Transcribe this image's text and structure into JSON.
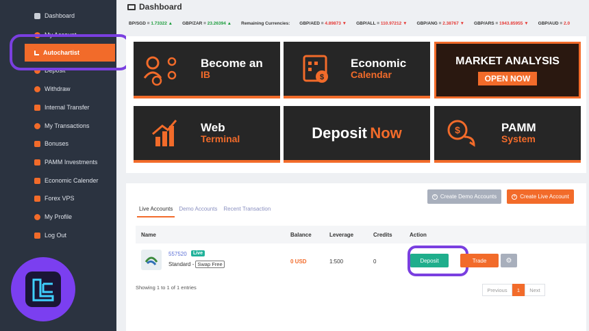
{
  "sidebar": {
    "items": [
      {
        "label": "Dashboard"
      },
      {
        "label": "My Account"
      },
      {
        "label": "Autochartist"
      },
      {
        "label": "Deposit"
      },
      {
        "label": "Withdraw"
      },
      {
        "label": "Internal Transfer"
      },
      {
        "label": "My Transactions"
      },
      {
        "label": "Bonuses"
      },
      {
        "label": "PAMM Investments"
      },
      {
        "label": "Economic Calender"
      },
      {
        "label": "Forex VPS"
      },
      {
        "label": "My Profile"
      },
      {
        "label": "Log Out"
      }
    ]
  },
  "header": {
    "title": "Dashboard"
  },
  "ticker": [
    {
      "pair": "BP/SGD =",
      "value": "1.73322 ▲",
      "dir": "up"
    },
    {
      "pair": "GBP/ZAR =",
      "value": "23.26394 ▲",
      "dir": "up"
    },
    {
      "pair": "Remaining Currencies:",
      "value": "",
      "dir": ""
    },
    {
      "pair": "GBP/AED =",
      "value": "4.89873 ▼",
      "dir": "down"
    },
    {
      "pair": "GBP/ALL =",
      "value": "110.97212 ▼",
      "dir": "down"
    },
    {
      "pair": "GBP/ANG =",
      "value": "2.38767 ▼",
      "dir": "down"
    },
    {
      "pair": "GBP/ARS =",
      "value": "1943.85955 ▼",
      "dir": "down"
    },
    {
      "pair": "GBP/AUD =",
      "value": "2.0",
      "dir": "down"
    }
  ],
  "banners": {
    "ib": {
      "line1": "Become an",
      "line2": "IB"
    },
    "calendar": {
      "line1": "Economic",
      "line2": "Calendar"
    },
    "market": {
      "title": "MARKET ANALYSIS",
      "button": "OPEN NOW"
    },
    "web": {
      "line1": "Web",
      "line2": "Terminal"
    },
    "deposit": {
      "word1": "Deposit",
      "word2": "Now"
    },
    "pamm": {
      "line1": "PAMM",
      "line2": "System"
    }
  },
  "accounts": {
    "create_demo": "Create Demo Accounts",
    "create_live": "Create Live Account",
    "tabs": [
      "Live Accounts",
      "Demo Accounts",
      "Recent Transaction"
    ],
    "columns": [
      "Name",
      "Balance",
      "Leverage",
      "Credits",
      "Action"
    ],
    "row": {
      "number": "557520",
      "badge": "Live",
      "type": "Standard -",
      "swap": "Swap Free",
      "balance": "0 USD",
      "leverage": "1:500",
      "credits": "0",
      "deposit_label": "Deposit",
      "trade_label": "Trade"
    },
    "showing": "Showing 1 to 1 of 1 entries",
    "pager": {
      "prev": "Previous",
      "page": "1",
      "next": "Next"
    }
  },
  "colors": {
    "accent": "#f26b2a",
    "sidebar": "#2b3340",
    "highlight": "#7a3fe0",
    "deposit": "#1fae8c"
  }
}
